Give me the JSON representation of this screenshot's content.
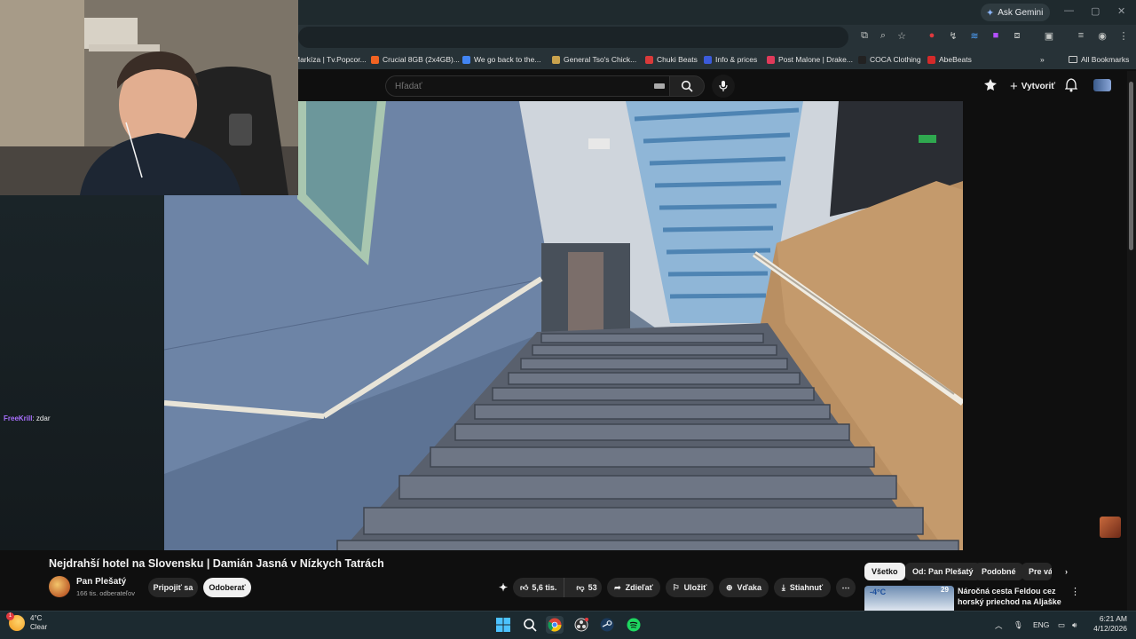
{
  "browser": {
    "gemini_label": "Ask Gemini",
    "bookmarks": [
      {
        "label": "Markíza | Tv.Popcor...",
        "color": "#2b2b2b"
      },
      {
        "label": "Crucial 8GB (2x4GB)...",
        "color": "#f26322"
      },
      {
        "label": "We go back to the...",
        "color": "#4285f4"
      },
      {
        "label": "General Tso's Chick...",
        "color": "#c9a24d"
      },
      {
        "label": "Chuki Beats",
        "color": "#d93a3a"
      },
      {
        "label": "Info & prices",
        "color": "#3b5bdb"
      },
      {
        "label": "Post Malone | Drake...",
        "color": "#e03a5a"
      },
      {
        "label": "COCA Clothing",
        "color": "#222222"
      },
      {
        "label": "AbeBeats",
        "color": "#d42a2a"
      }
    ],
    "all_bookmarks": "All Bookmarks"
  },
  "youtube": {
    "search_placeholder": "Hľadať",
    "create_label": "Vytvoriť",
    "video_title": "Nejdrahší hotel na Slovensku | Damián Jasná v Nízkych Tatrách",
    "channel_name": "Pan Plešatý",
    "subscribers": "166 tis. odberateľov",
    "join_label": "Pripojiť sa",
    "subscribe_label": "Odoberať",
    "like_count": "5,6 tis.",
    "dislike_count": "53",
    "share_label": "Zdieľať",
    "save_label": "Uložiť",
    "thanks_label": "Vďaka",
    "download_label": "Stiahnuť",
    "chips": [
      "Všetko",
      "Od: Pan Plešatý",
      "Podobné",
      "Pre vá"
    ],
    "reco": {
      "title": "Náročná cesta Feldou cez horský priechod na Aljaške na ...",
      "badge": "29",
      "thumb_text": "-4°C"
    }
  },
  "chat": {
    "user": "FreeKrill",
    "message": ": zdar"
  },
  "taskbar": {
    "temperature": "4°C",
    "condition": "Clear",
    "notif_count": "1",
    "language": "ENG",
    "time": "6:21 AM",
    "date": "4/12/2026"
  },
  "colors": {
    "accent_chat_user": "#a970ff",
    "yt_background": "#0f0f0f"
  }
}
